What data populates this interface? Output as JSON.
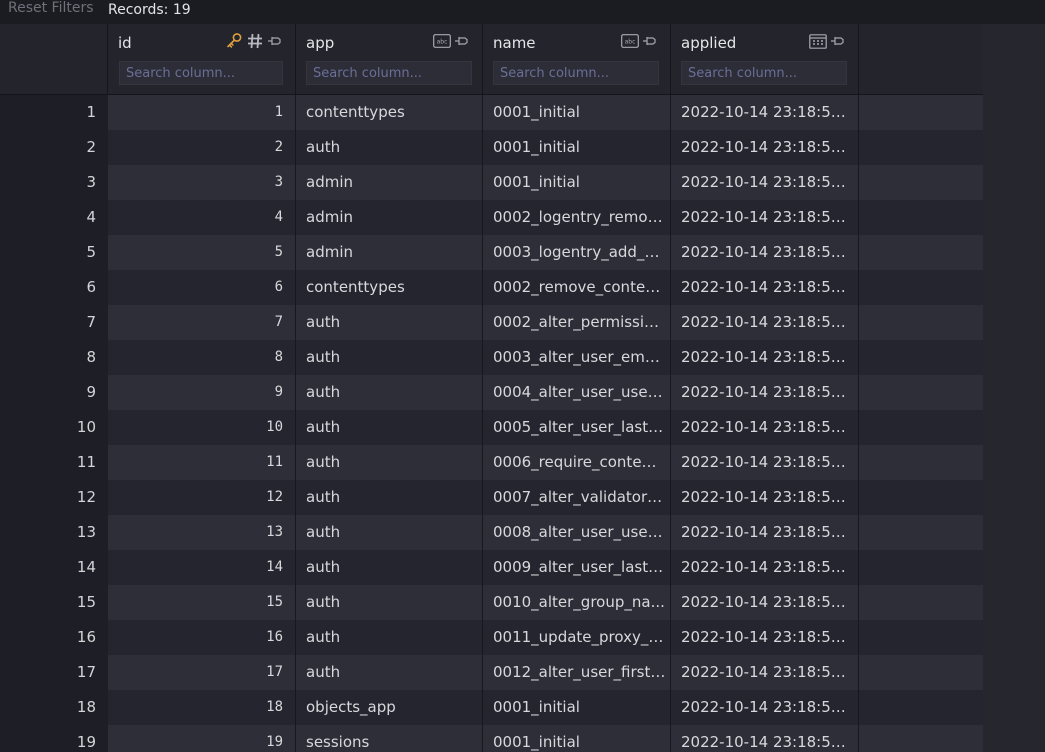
{
  "toolbar": {
    "reset_filters": "Reset Filters",
    "records": "Records: 19"
  },
  "columns": [
    {
      "title": "id",
      "placeholder": "Search column...",
      "icons": [
        "key-icon",
        "hash-icon",
        "pin-icon"
      ]
    },
    {
      "title": "app",
      "placeholder": "Search column...",
      "icons": [
        "text-type-icon",
        "pin-icon"
      ]
    },
    {
      "title": "name",
      "placeholder": "Search column...",
      "icons": [
        "text-type-icon",
        "pin-icon"
      ]
    },
    {
      "title": "applied",
      "placeholder": "Search column...",
      "icons": [
        "calendar-icon",
        "pin-icon"
      ]
    }
  ],
  "colors": {
    "key": "#e0a040",
    "accent_placeholder": "#6a6f96"
  },
  "rows": [
    {
      "rn": "1",
      "id": "1",
      "app": "contenttypes",
      "name": "0001_initial",
      "applied": "2022-10-14 23:18:54...."
    },
    {
      "rn": "2",
      "id": "2",
      "app": "auth",
      "name": "0001_initial",
      "applied": "2022-10-14 23:18:54...."
    },
    {
      "rn": "3",
      "id": "3",
      "app": "admin",
      "name": "0001_initial",
      "applied": "2022-10-14 23:18:54...."
    },
    {
      "rn": "4",
      "id": "4",
      "app": "admin",
      "name": "0002_logentry_remov...",
      "applied": "2022-10-14 23:18:54...."
    },
    {
      "rn": "5",
      "id": "5",
      "app": "admin",
      "name": "0003_logentry_add_a...",
      "applied": "2022-10-14 23:18:54...."
    },
    {
      "rn": "6",
      "id": "6",
      "app": "contenttypes",
      "name": "0002_remove_conten...",
      "applied": "2022-10-14 23:18:54...."
    },
    {
      "rn": "7",
      "id": "7",
      "app": "auth",
      "name": "0002_alter_permissio...",
      "applied": "2022-10-14 23:18:54...."
    },
    {
      "rn": "8",
      "id": "8",
      "app": "auth",
      "name": "0003_alter_user_emai...",
      "applied": "2022-10-14 23:18:54...."
    },
    {
      "rn": "9",
      "id": "9",
      "app": "auth",
      "name": "0004_alter_user_user...",
      "applied": "2022-10-14 23:18:54...."
    },
    {
      "rn": "10",
      "id": "10",
      "app": "auth",
      "name": "0005_alter_user_last_l...",
      "applied": "2022-10-14 23:18:54...."
    },
    {
      "rn": "11",
      "id": "11",
      "app": "auth",
      "name": "0006_require_content...",
      "applied": "2022-10-14 23:18:54...."
    },
    {
      "rn": "12",
      "id": "12",
      "app": "auth",
      "name": "0007_alter_validators...",
      "applied": "2022-10-14 23:18:54...."
    },
    {
      "rn": "13",
      "id": "13",
      "app": "auth",
      "name": "0008_alter_user_user...",
      "applied": "2022-10-14 23:18:54...."
    },
    {
      "rn": "14",
      "id": "14",
      "app": "auth",
      "name": "0009_alter_user_last_...",
      "applied": "2022-10-14 23:18:54...."
    },
    {
      "rn": "15",
      "id": "15",
      "app": "auth",
      "name": "0010_alter_group_na...",
      "applied": "2022-10-14 23:18:54...."
    },
    {
      "rn": "16",
      "id": "16",
      "app": "auth",
      "name": "0011_update_proxy_p...",
      "applied": "2022-10-14 23:18:54...."
    },
    {
      "rn": "17",
      "id": "17",
      "app": "auth",
      "name": "0012_alter_user_first_...",
      "applied": "2022-10-14 23:18:54...."
    },
    {
      "rn": "18",
      "id": "18",
      "app": "objects_app",
      "name": "0001_initial",
      "applied": "2022-10-14 23:18:54...."
    },
    {
      "rn": "19",
      "id": "19",
      "app": "sessions",
      "name": "0001_initial",
      "applied": "2022-10-14 23:18:54...."
    }
  ]
}
